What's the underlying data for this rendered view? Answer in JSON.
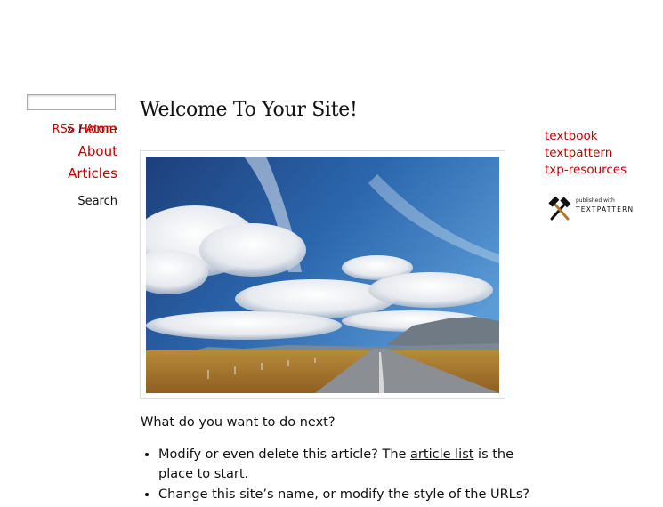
{
  "nav": {
    "arrow": "»",
    "items": [
      {
        "label": "Home"
      },
      {
        "label": "About"
      },
      {
        "label": "Articles"
      }
    ]
  },
  "search": {
    "label": "Search",
    "value": "",
    "placeholder": ""
  },
  "feeds": {
    "rss": "RSS",
    "separator": " / ",
    "atom": "Atom"
  },
  "article": {
    "title": "Welcome To Your Site!",
    "intro": "What do you want to do next?",
    "bullet1_before": "Modify or even delete this article? The ",
    "bullet1_link": "article list",
    "bullet1_after": " is the place to start.",
    "bullet2": "Change this site’s name, or modify the style of the URLs?"
  },
  "links": [
    "textbook",
    "textpattern",
    "txp-resources"
  ],
  "badge": {
    "published_with": "published with",
    "brand": "TEXTPATTERN"
  },
  "colors": {
    "link": "#c00000",
    "text": "#111111",
    "background": "#ffffff"
  }
}
